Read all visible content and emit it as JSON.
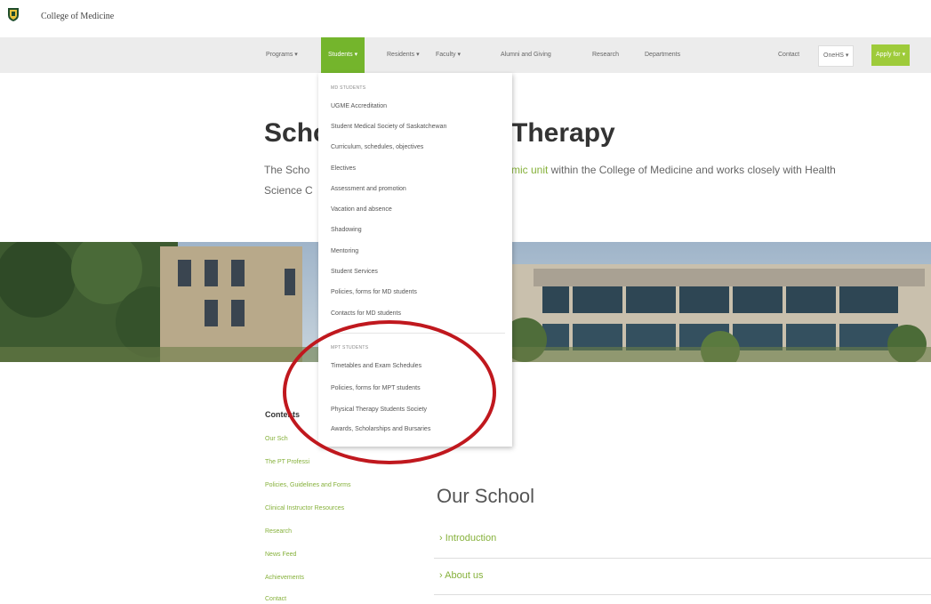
{
  "header": {
    "college": "College of Medicine",
    "shield_icon": "shield-icon"
  },
  "nav": {
    "programs": "Programs ▾",
    "students": "Students ▾",
    "residents": "Residents ▾",
    "faculty": "Faculty ▾",
    "alumni": "Alumni and Giving",
    "research": "Research",
    "departments": "Departments",
    "contact": "Contact",
    "onehs": "OneHS ▾",
    "apply": "Apply for ▾"
  },
  "page": {
    "title_left": "Scho",
    "title_right": "Therapy",
    "intro_a": "The Scho",
    "intro_b": "Science C",
    "intro_link": "mic unit",
    "intro_rest": " within the College of Medicine and works closely with Health"
  },
  "dropdown": {
    "md_heading": "MD STUDENTS",
    "md_items": [
      "UGME Accreditation",
      "Student Medical Society of Saskatchewan",
      "Curriculum, schedules, objectives",
      "Electives",
      "Assessment and promotion",
      "Vacation and absence",
      "Shadowing",
      "Mentoring",
      "Student Services",
      "Policies, forms for MD students",
      "Contacts for MD students"
    ],
    "mpt_heading": "MPT STUDENTS",
    "mpt_items": [
      "Timetables and Exam Schedules",
      "Policies, forms for MPT students",
      "Physical Therapy Students Society",
      "Awards, Scholarships and Bursaries"
    ]
  },
  "contents": {
    "title": "Contents",
    "items": [
      "Our Sch",
      "The PT Professi",
      "Policies, Guidelines and Forms",
      "Clinical Instructor Resources",
      "Research",
      "News Feed",
      "Achievements",
      "Contact"
    ]
  },
  "school": {
    "title": "Our School",
    "accordions": [
      "Introduction",
      "About us"
    ]
  },
  "colors": {
    "accent": "#74b52c",
    "link": "#86b13b",
    "highlight_circle": "#c0181e"
  }
}
